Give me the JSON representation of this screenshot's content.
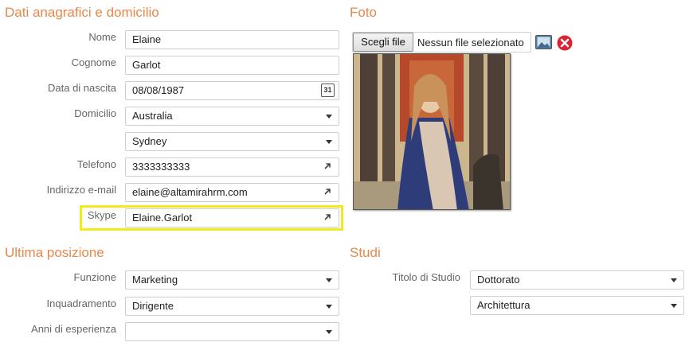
{
  "sections": {
    "personal": "Dati anagrafici e domicilio",
    "photo": "Foto",
    "position": "Ultima posizione",
    "studies": "Studi"
  },
  "personal": {
    "name_label": "Nome",
    "name_value": "Elaine",
    "surname_label": "Cognome",
    "surname_value": "Garlot",
    "birth_label": "Data di nascita",
    "birth_value": "08/08/1987",
    "calendar_day": "31",
    "domicile_label": "Domicilio",
    "country_value": "Australia",
    "city_value": "Sydney",
    "phone_label": "Telefono",
    "phone_value": "3333333333",
    "email_label": "Indirizzo e-mail",
    "email_value": "elaine@altamirahrm.com",
    "skype_label": "Skype",
    "skype_value": "Elaine.Garlot"
  },
  "photo": {
    "choose_button": "Scegli file",
    "file_status": "Nessun file selezionato"
  },
  "position": {
    "function_label": "Funzione",
    "function_value": "Marketing",
    "level_label": "Inquadramento",
    "level_value": "Dirigente",
    "experience_label": "Anni di esperienza",
    "experience_value": ""
  },
  "studies": {
    "degree_label": "Titolo di Studio",
    "degree_value": "Dottorato",
    "field_value": "Architettura"
  },
  "colors": {
    "section_title": "#e8874a",
    "highlight": "#f2ea1a",
    "delete": "#e0202f"
  },
  "icons": [
    "calendar-icon",
    "external-link-icon",
    "image-icon",
    "delete-icon",
    "dropdown-arrow-icon"
  ]
}
